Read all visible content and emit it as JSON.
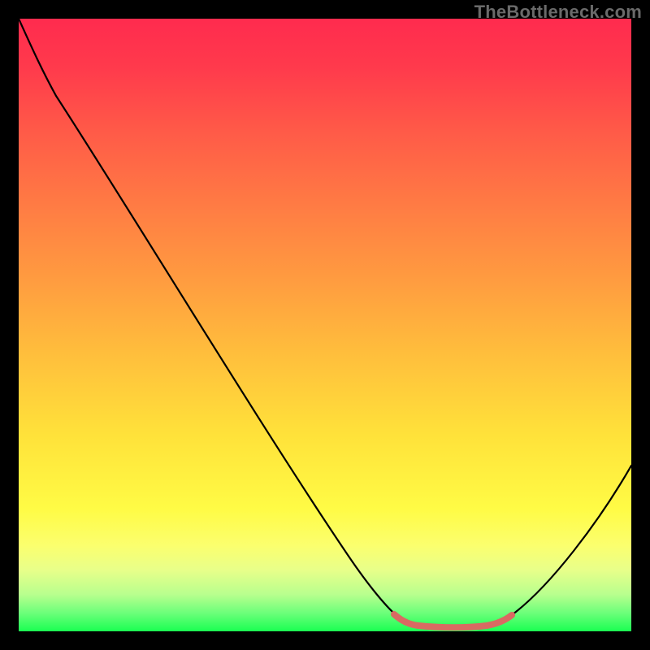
{
  "watermark": "TheBottleneck.com",
  "chart_data": {
    "type": "line",
    "title": "",
    "xlabel": "",
    "ylabel": "",
    "xlim": [
      0,
      100
    ],
    "ylim": [
      0,
      100
    ],
    "grid": false,
    "legend": false,
    "series": [
      {
        "name": "bottleneck-curve",
        "x_pct": [
          0,
          6,
          12,
          20,
          28,
          36,
          44,
          52,
          58,
          62,
          65,
          68,
          72,
          75,
          78,
          82,
          86,
          90,
          94,
          100
        ],
        "y_pct": [
          100,
          93,
          85,
          76.5,
          67,
          57,
          47,
          36,
          26,
          17,
          10,
          5,
          1.5,
          0.5,
          0.8,
          2.5,
          6,
          11,
          18,
          30
        ]
      }
    ],
    "highlight_segment": {
      "name": "optimal-range",
      "x_start_pct": 62,
      "x_end_pct": 78,
      "implied_x_units": "percent of horizontal axis"
    },
    "annotations": [],
    "background": "vertical-gradient red→yellow→green (high bottleneck → low bottleneck)"
  }
}
